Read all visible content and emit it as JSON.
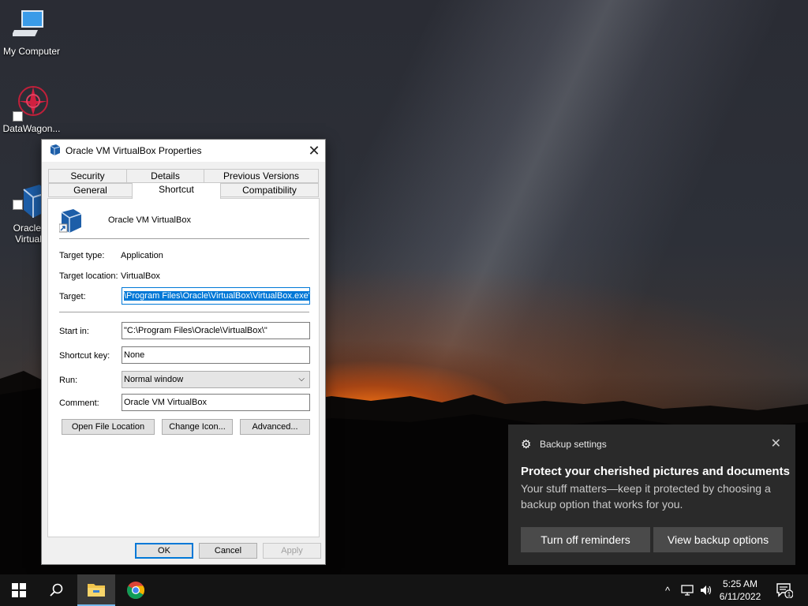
{
  "desktop": {
    "icons": [
      {
        "label": "My Computer"
      },
      {
        "label": "DataWagon..."
      },
      {
        "label": "Oracle V\nVirtualB"
      }
    ]
  },
  "dialog": {
    "title": "Oracle VM VirtualBox Properties",
    "tabs_row1": [
      "Security",
      "Details",
      "Previous Versions"
    ],
    "tabs_row2": [
      "General",
      "Shortcut",
      "Compatibility"
    ],
    "active_tab": "Shortcut",
    "app_name": "Oracle VM VirtualBox",
    "target_type_label": "Target type:",
    "target_type_value": "Application",
    "target_location_label": "Target location:",
    "target_location_value": "VirtualBox",
    "target_label": "Target:",
    "target_value": "\\Program Files\\Oracle\\VirtualBox\\VirtualBox.exe\"",
    "start_in_label": "Start in:",
    "start_in_value": "\"C:\\Program Files\\Oracle\\VirtualBox\\\"",
    "shortcut_key_label": "Shortcut key:",
    "shortcut_key_value": "None",
    "run_label": "Run:",
    "run_value": "Normal window",
    "comment_label": "Comment:",
    "comment_value": "Oracle VM VirtualBox",
    "buttons": {
      "open_file_location": "Open File Location",
      "change_icon": "Change Icon...",
      "advanced": "Advanced...",
      "ok": "OK",
      "cancel": "Cancel",
      "apply": "Apply"
    }
  },
  "toast": {
    "app": "Backup settings",
    "title": "Protect your cherished pictures and documents",
    "body": "Your stuff matters—keep it protected by choosing a backup option that works for you.",
    "btn_off": "Turn off reminders",
    "btn_view": "View backup options"
  },
  "taskbar": {
    "time": "5:25 AM",
    "date": "6/11/2022",
    "notification_count": "1"
  },
  "colors": {
    "accent": "#0078d7",
    "toast_bg": "#2b2b2b",
    "taskbar_bg": "#141414"
  }
}
